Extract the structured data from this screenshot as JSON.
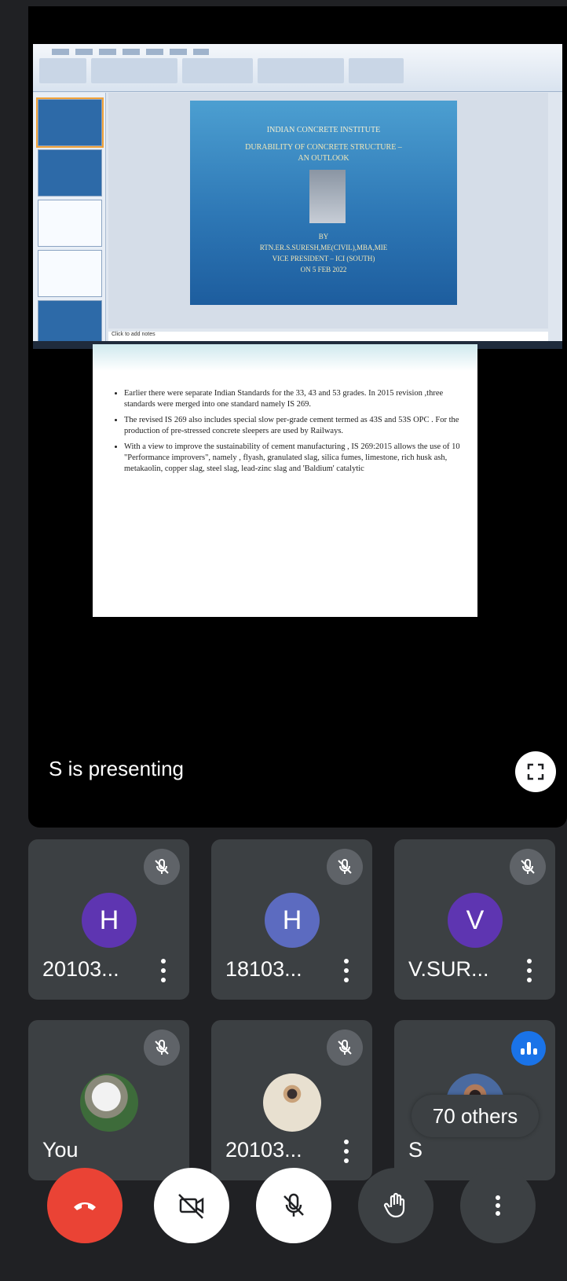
{
  "presentation": {
    "presenter_label": "S is presenting",
    "slide_title": {
      "org": "INDIAN CONCRETE INSTITUTE",
      "title_line1": "DURABILITY OF CONCRETE STRUCTURE –",
      "title_line2": "AN OUTLOOK",
      "by": "BY",
      "author": "RTN.ER.S.SURESH,ME(CIVIL),MBA,MIE",
      "role": "VICE PRESIDENT – ICI (SOUTH)",
      "date": "ON 5 FEB 2022"
    },
    "notes_placeholder": "Click to add notes",
    "slide_bullets": [
      "Earlier there were separate Indian Standards for the 33, 43 and 53 grades. In 2015 revision ,three standards were merged into one standard namely IS 269.",
      "The revised IS 269 also includes special slow per-grade cement termed as 43S and 53S OPC . For the production of pre-stressed concrete sleepers are used by Railways.",
      "With a view to improve the sustainability of cement manufacturing , IS 269:2015 allows the use of 10 \"Performance improvers\", namely , flyash, granulated slag, silica fumes, limestone, rich husk ash, metakaolin, copper slag, steel slag, lead-zinc slag and 'Baldium' catalytic"
    ]
  },
  "participants": [
    {
      "name": "20103...",
      "initial": "H",
      "color": "#5e35b1",
      "muted": true
    },
    {
      "name": "18103...",
      "initial": "H",
      "color": "#5c6bc0",
      "muted": true
    },
    {
      "name": "V.SUR...",
      "initial": "V",
      "color": "#5e35b1",
      "muted": true
    },
    {
      "name": "You",
      "muted": true
    },
    {
      "name": "20103...",
      "muted": true
    },
    {
      "name": "S",
      "speaking": true
    }
  ],
  "others_label": "70 others",
  "controls": {
    "end_call_color": "#ea4335",
    "camera": "camera-off-icon",
    "mic": "mic-off-icon",
    "raise_hand": "raise-hand-icon",
    "more": "more-options-icon"
  }
}
